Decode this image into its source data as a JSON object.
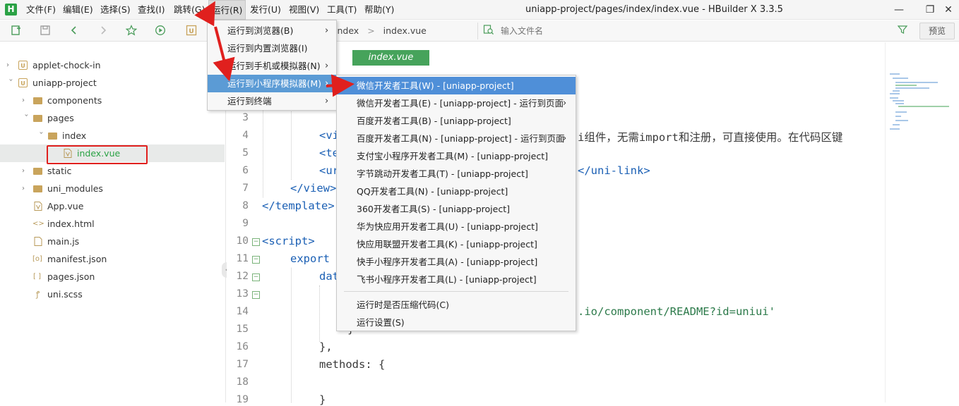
{
  "window": {
    "title": "uniapp-project/pages/index/index.vue - HBuilder X 3.3.5",
    "logo": "H",
    "minimize": "—",
    "restore": "❐",
    "close": "✕"
  },
  "menubar": [
    {
      "label": "文件(F)"
    },
    {
      "label": "编辑(E)"
    },
    {
      "label": "选择(S)"
    },
    {
      "label": "查找(I)"
    },
    {
      "label": "跳转(G)"
    },
    {
      "label": "运行(R)"
    },
    {
      "label": "发行(U)"
    },
    {
      "label": "视图(V)"
    },
    {
      "label": "工具(T)"
    },
    {
      "label": "帮助(Y)"
    }
  ],
  "toolbar": {
    "breadcrumb": [
      "index",
      "index.vue"
    ],
    "breadcrumb_sep": ">",
    "filter_placeholder": "输入文件名",
    "preview_label": "预览",
    "icons": [
      "new-file-icon",
      "save-icon",
      "back-icon",
      "forward-icon",
      "star-icon",
      "run-icon",
      "uni-icon",
      "filter-icon",
      "search-file-icon"
    ]
  },
  "sidebar": {
    "items": [
      {
        "label": "applet-chock-in",
        "icon": "project-icon",
        "expanded": false
      },
      {
        "label": "uniapp-project",
        "icon": "project-icon",
        "expanded": true
      },
      {
        "label": "components",
        "icon": "folder-icon",
        "expanded": false
      },
      {
        "label": "pages",
        "icon": "folder-icon",
        "expanded": true
      },
      {
        "label": "index",
        "icon": "folder-icon",
        "expanded": true
      },
      {
        "label": "index.vue",
        "icon": "vue-file-icon",
        "selected": true
      },
      {
        "label": "static",
        "icon": "folder-icon",
        "expanded": false
      },
      {
        "label": "uni_modules",
        "icon": "folder-icon",
        "expanded": false
      },
      {
        "label": "App.vue",
        "icon": "vue-file-icon"
      },
      {
        "label": "index.html",
        "icon": "html-file-icon"
      },
      {
        "label": "main.js",
        "icon": "js-file-icon"
      },
      {
        "label": "manifest.json",
        "icon": "json-config-icon"
      },
      {
        "label": "pages.json",
        "icon": "json-file-icon"
      },
      {
        "label": "uni.scss",
        "icon": "scss-file-icon"
      }
    ]
  },
  "editor": {
    "tab_label": "index.vue",
    "line_numbers": [
      "3",
      "4",
      "5",
      "6",
      "7",
      "8",
      "9",
      "10",
      "11",
      "12",
      "13",
      "14",
      "15",
      "16",
      "17",
      "18",
      "19"
    ],
    "code": {
      "l4": "<vi",
      "l4_tail": "i组件，无需import和注册，可直接使用。在代码区键",
      "l5": "<te",
      "l6": "<ur",
      "l6_tail": "</uni-link>",
      "l7": "</view>",
      "l8": "</template>",
      "l10": "<script>",
      "l11": "export",
      "l12": "dat",
      "l14_tail": ".io/component/README?id=uniui'",
      "l15": "}",
      "l16": "},",
      "l17": "methods: {",
      "l19": "}"
    }
  },
  "run_menu": {
    "items": [
      {
        "label": "运行到浏览器(B)",
        "submenu": true
      },
      {
        "label": "运行到内置浏览器(I)",
        "submenu": false
      },
      {
        "label": "运行到手机或模拟器(N)",
        "submenu": true
      },
      {
        "label": "运行到小程序模拟器(M)",
        "submenu": true,
        "highlighted": true
      },
      {
        "label": "运行到终端",
        "submenu": true
      }
    ]
  },
  "miniprogram_menu": {
    "items": [
      {
        "label": "微信开发者工具(W) - [uniapp-project]",
        "highlighted": true
      },
      {
        "label": "微信开发者工具(E) - [uniapp-project] - 运行到页面",
        "submenu": true
      },
      {
        "label": "百度开发者工具(B) - [uniapp-project]"
      },
      {
        "label": "百度开发者工具(N) - [uniapp-project] - 运行到页面",
        "submenu": true
      },
      {
        "label": "支付宝小程序开发者工具(M) - [uniapp-project]"
      },
      {
        "label": "字节跳动开发者工具(T) - [uniapp-project]"
      },
      {
        "label": "QQ开发者工具(N) - [uniapp-project]"
      },
      {
        "label": "360开发者工具(S) - [uniapp-project]"
      },
      {
        "label": "华为快应用开发者工具(U) - [uniapp-project]"
      },
      {
        "label": "快应用联盟开发者工具(K) - [uniapp-project]"
      },
      {
        "label": "快手小程序开发者工具(A) - [uniapp-project]"
      },
      {
        "label": "飞书小程序开发者工具(L) - [uniapp-project]"
      }
    ],
    "footer_items": [
      {
        "label": "运行时是否压缩代码(C)"
      },
      {
        "label": "运行设置(S)"
      }
    ]
  },
  "colors": {
    "accent_green": "#46a35b",
    "menu_highlight": "#5b9bd5",
    "annotation_red": "#e0201e"
  }
}
